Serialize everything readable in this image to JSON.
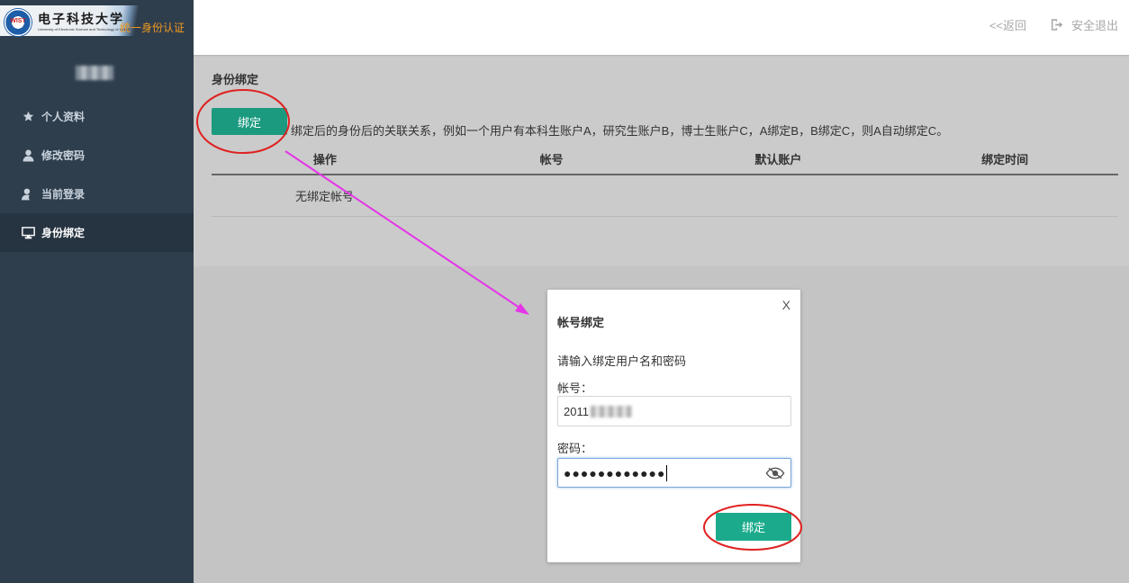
{
  "logo": {
    "emblem_text": "WIST",
    "school_name": "电子科技大学",
    "school_name_en": "University of Electronic Science and Technology of China",
    "subtitle": "统一身份认证"
  },
  "sidebar": {
    "items": [
      {
        "label": "个人资料",
        "icon": "star-icon"
      },
      {
        "label": "修改密码",
        "icon": "user-icon"
      },
      {
        "label": "当前登录",
        "icon": "user-clock-icon"
      },
      {
        "label": "身份绑定",
        "icon": "monitor-icon",
        "active": true
      }
    ]
  },
  "header": {
    "back_label": "<<返回",
    "logout_label": "安全退出"
  },
  "panel": {
    "title": "身份绑定",
    "bind_button": "绑定",
    "note": "绑定后的身份后的关联关系，例如一个用户有本科生账户A，研究生账户B，博士生账户C，A绑定B，B绑定C，则A自动绑定C。",
    "table": {
      "columns": [
        "操作",
        "帐号",
        "默认账户",
        "绑定时间"
      ],
      "empty_text": "无绑定帐号"
    }
  },
  "modal": {
    "close_label": "X",
    "title": "帐号绑定",
    "hint": "请输入绑定用户名和密码",
    "account_label": "帐号：",
    "account_value": "2011",
    "password_label": "密码：",
    "password_value": "●●●●●●●●●●●●",
    "submit_label": "绑定"
  },
  "colors": {
    "sidebar_bg": "#2f3e4d",
    "button_green": "#1b9a80",
    "annotation_red": "#e02020",
    "annotation_arrow": "#e535e8"
  }
}
